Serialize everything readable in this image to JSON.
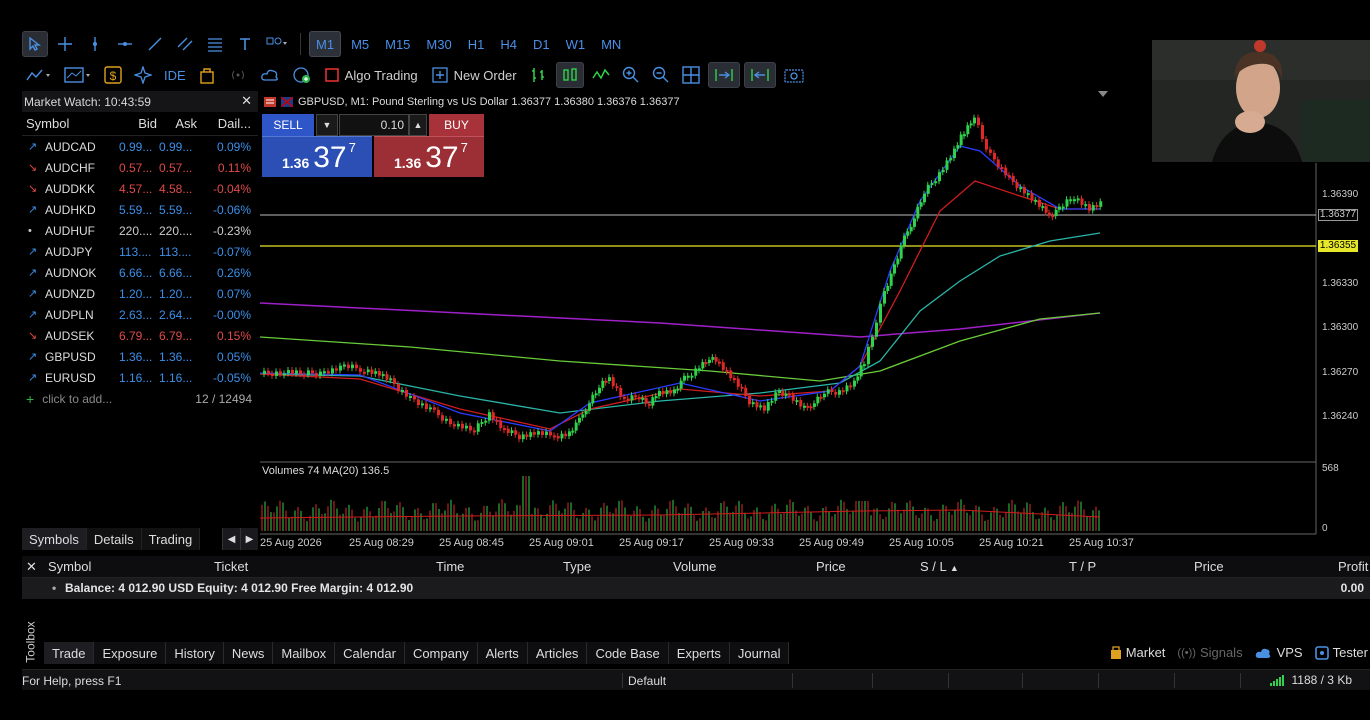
{
  "toolbar": {
    "timeframes": [
      "M1",
      "M5",
      "M15",
      "M30",
      "H1",
      "H4",
      "D1",
      "W1",
      "MN"
    ],
    "active_timeframe": "M1",
    "ide_label": "IDE",
    "algo_trading_label": "Algo Trading",
    "new_order_label": "New Order"
  },
  "market_watch": {
    "title": "Market Watch: 10:43:59",
    "columns": [
      "Symbol",
      "Bid",
      "Ask",
      "Dail..."
    ],
    "rows": [
      {
        "symbol": "AUDCAD",
        "bid": "0.99...",
        "ask": "0.99...",
        "daily": "0.09%",
        "dir": "up"
      },
      {
        "symbol": "AUDCHF",
        "bid": "0.57...",
        "ask": "0.57...",
        "daily": "0.11%",
        "dir": "dn"
      },
      {
        "symbol": "AUDDKK",
        "bid": "4.57...",
        "ask": "4.58...",
        "daily": "-0.04%",
        "dir": "dn"
      },
      {
        "symbol": "AUDHKD",
        "bid": "5.59...",
        "ask": "5.59...",
        "daily": "-0.06%",
        "dir": "up"
      },
      {
        "symbol": "AUDHUF",
        "bid": "220....",
        "ask": "220....",
        "daily": "-0.23%",
        "dir": "neutral"
      },
      {
        "symbol": "AUDJPY",
        "bid": "113....",
        "ask": "113....",
        "daily": "-0.07%",
        "dir": "up"
      },
      {
        "symbol": "AUDNOK",
        "bid": "6.66...",
        "ask": "6.66...",
        "daily": "0.26%",
        "dir": "up"
      },
      {
        "symbol": "AUDNZD",
        "bid": "1.20...",
        "ask": "1.20...",
        "daily": "0.07%",
        "dir": "up"
      },
      {
        "symbol": "AUDPLN",
        "bid": "2.63...",
        "ask": "2.64...",
        "daily": "-0.00%",
        "dir": "up"
      },
      {
        "symbol": "AUDSEK",
        "bid": "6.79...",
        "ask": "6.79...",
        "daily": "0.15%",
        "dir": "dn"
      },
      {
        "symbol": "GBPUSD",
        "bid": "1.36...",
        "ask": "1.36...",
        "daily": "0.05%",
        "dir": "up"
      },
      {
        "symbol": "EURUSD",
        "bid": "1.16...",
        "ask": "1.16...",
        "daily": "-0.05%",
        "dir": "up"
      }
    ],
    "add_label": "click to add...",
    "count": "12 / 12494",
    "tabs": [
      "Symbols",
      "Details",
      "Trading"
    ],
    "active_tab": "Symbols"
  },
  "chart": {
    "title": "GBPUSD, M1:  Pound Sterling vs US Dollar  1.36377 1.36380 1.36376 1.36377",
    "sell_label": "SELL",
    "buy_label": "BUY",
    "lot": "0.10",
    "sell_price": {
      "small": "1.36",
      "big": "37",
      "sup": "7"
    },
    "buy_price": {
      "small": "1.36",
      "big": "37",
      "sup": "7"
    },
    "price_ticks": [
      "1.36390",
      "1.36330",
      "1.36300",
      "1.36270",
      "1.36240"
    ],
    "current_price_tag": "1.36377",
    "line_price_tag": "1.36355",
    "volume_label": "Volumes 74 MA(20) 136.5",
    "volume_axis_top": "568",
    "volume_axis_bottom": "0",
    "time_ticks": [
      "25 Aug 2026",
      "25 Aug 08:29",
      "25 Aug 08:45",
      "25 Aug 09:01",
      "25 Aug 09:17",
      "25 Aug 09:33",
      "25 Aug 09:49",
      "25 Aug 10:05",
      "25 Aug 10:21",
      "25 Aug 10:37"
    ],
    "colors": {
      "bull": "#2fd24a",
      "bear": "#e02828",
      "ma_blue": "#2a3cff",
      "ma_red": "#d01c1c",
      "ma_teal": "#2bb5a8",
      "ma_green": "#6acb3a",
      "ma_purple": "#a020c8",
      "hline_yellow": "#e8e82a"
    }
  },
  "toolbox": {
    "columns": [
      "Symbol",
      "Ticket",
      "Time",
      "Type",
      "Volume",
      "Price",
      "S / L",
      "T / P",
      "Price",
      "Profit"
    ],
    "balance_text": "Balance: 4 012.90 USD  Equity: 4 012.90  Free Margin: 4 012.90",
    "profit": "0.00",
    "vertical_label": "Toolbox",
    "tabs": [
      "Trade",
      "Exposure",
      "History",
      "News",
      "Mailbox",
      "Calendar",
      "Company",
      "Alerts",
      "Articles",
      "Code Base",
      "Experts",
      "Journal"
    ],
    "active_tab": "Trade",
    "right_items": {
      "market": "Market",
      "signals": "Signals",
      "vps": "VPS",
      "tester": "Tester"
    }
  },
  "status": {
    "help": "For Help, press F1",
    "profile": "Default",
    "connection": "1188 / 3 Kb"
  }
}
